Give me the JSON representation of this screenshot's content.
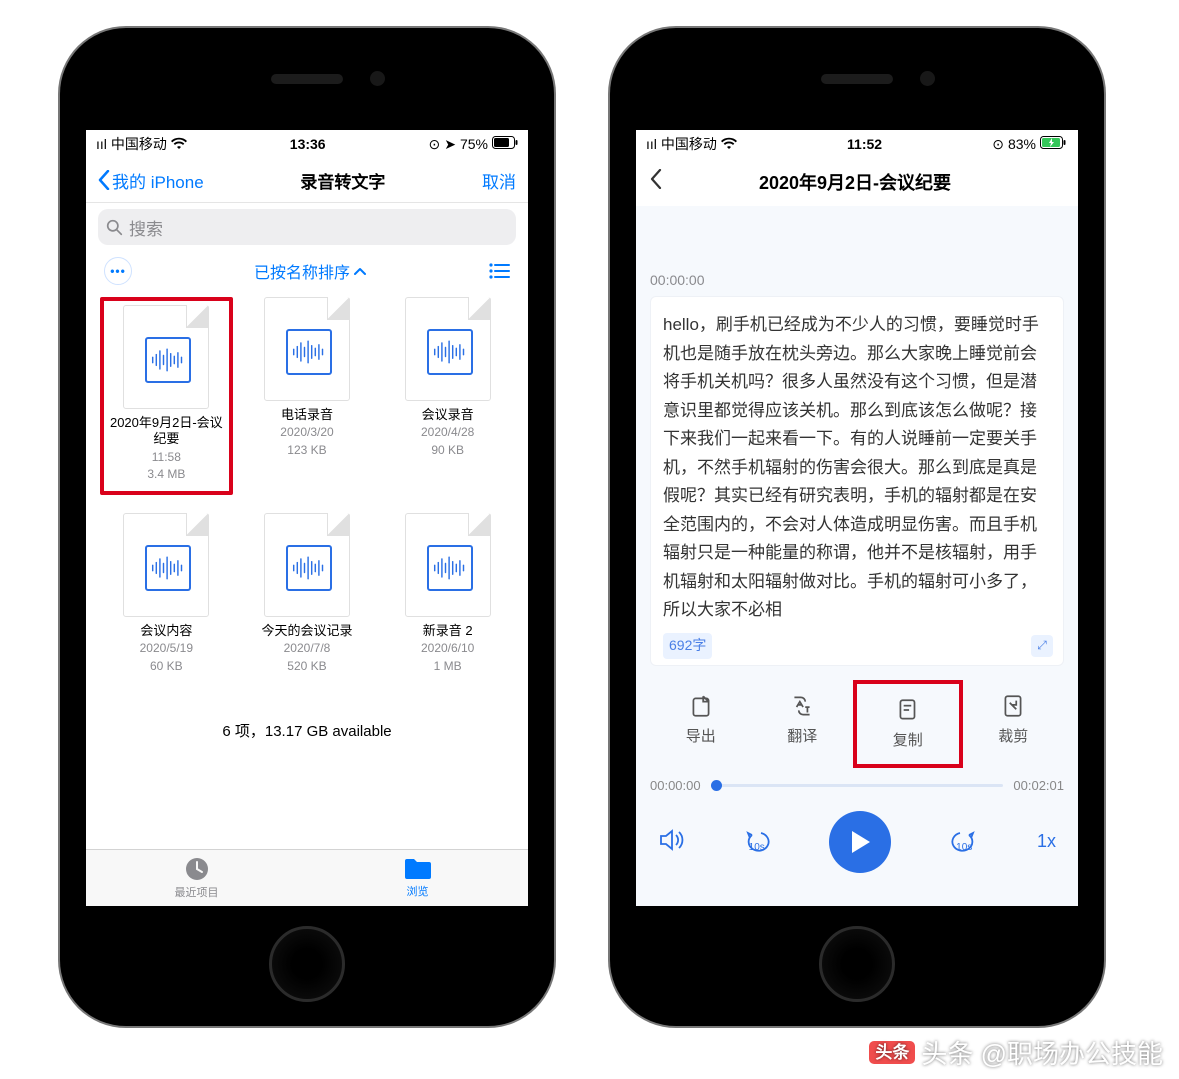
{
  "phone1": {
    "status": {
      "carrier": "中国移动",
      "time": "13:36",
      "battery": "75%"
    },
    "nav": {
      "back": "我的 iPhone",
      "title": "录音转文字",
      "cancel": "取消"
    },
    "search_placeholder": "搜索",
    "sort_label": "已按名称排序",
    "files": [
      {
        "name": "2020年9月2日-会议纪要",
        "date": "11:58",
        "size": "3.4 MB",
        "highlight": true
      },
      {
        "name": "电话录音",
        "date": "2020/3/20",
        "size": "123 KB"
      },
      {
        "name": "会议录音",
        "date": "2020/4/28",
        "size": "90 KB"
      },
      {
        "name": "会议内容",
        "date": "2020/5/19",
        "size": "60 KB"
      },
      {
        "name": "今天的会议记录",
        "date": "2020/7/8",
        "size": "520 KB"
      },
      {
        "name": "新录音 2",
        "date": "2020/6/10",
        "size": "1 MB"
      }
    ],
    "footer": "6 项，13.17 GB available",
    "tabs": {
      "recent": "最近项目",
      "browse": "浏览"
    }
  },
  "phone2": {
    "status": {
      "carrier": "中国移动",
      "time": "11:52",
      "battery": "83%"
    },
    "title": "2020年9月2日-会议纪要",
    "timestamp": "00:00:00",
    "transcript": "hello，刷手机已经成为不少人的习惯，要睡觉时手机也是随手放在枕头旁边。那么大家晚上睡觉前会将手机关机吗？很多人虽然没有这个习惯，但是潜意识里都觉得应该关机。那么到底该怎么做呢？接下来我们一起来看一下。有的人说睡前一定要关手机，不然手机辐射的伤害会很大。那么到底是真是假呢？其实已经有研究表明，手机的辐射都是在安全范围内的，不会对人体造成明显伤害。而且手机辐射只是一种能量的称谓，他并不是核辐射，用手机辐射和太阳辐射做对比。手机的辐射可小多了，所以大家不必相",
    "char_count": "692字",
    "actions": {
      "export": "导出",
      "translate": "翻译",
      "copy": "复制",
      "crop": "裁剪"
    },
    "progress": {
      "start": "00:00:00",
      "end": "00:02:01"
    },
    "speed": "1x",
    "skip": "10s"
  },
  "watermark": "头条 @职场办公技能"
}
